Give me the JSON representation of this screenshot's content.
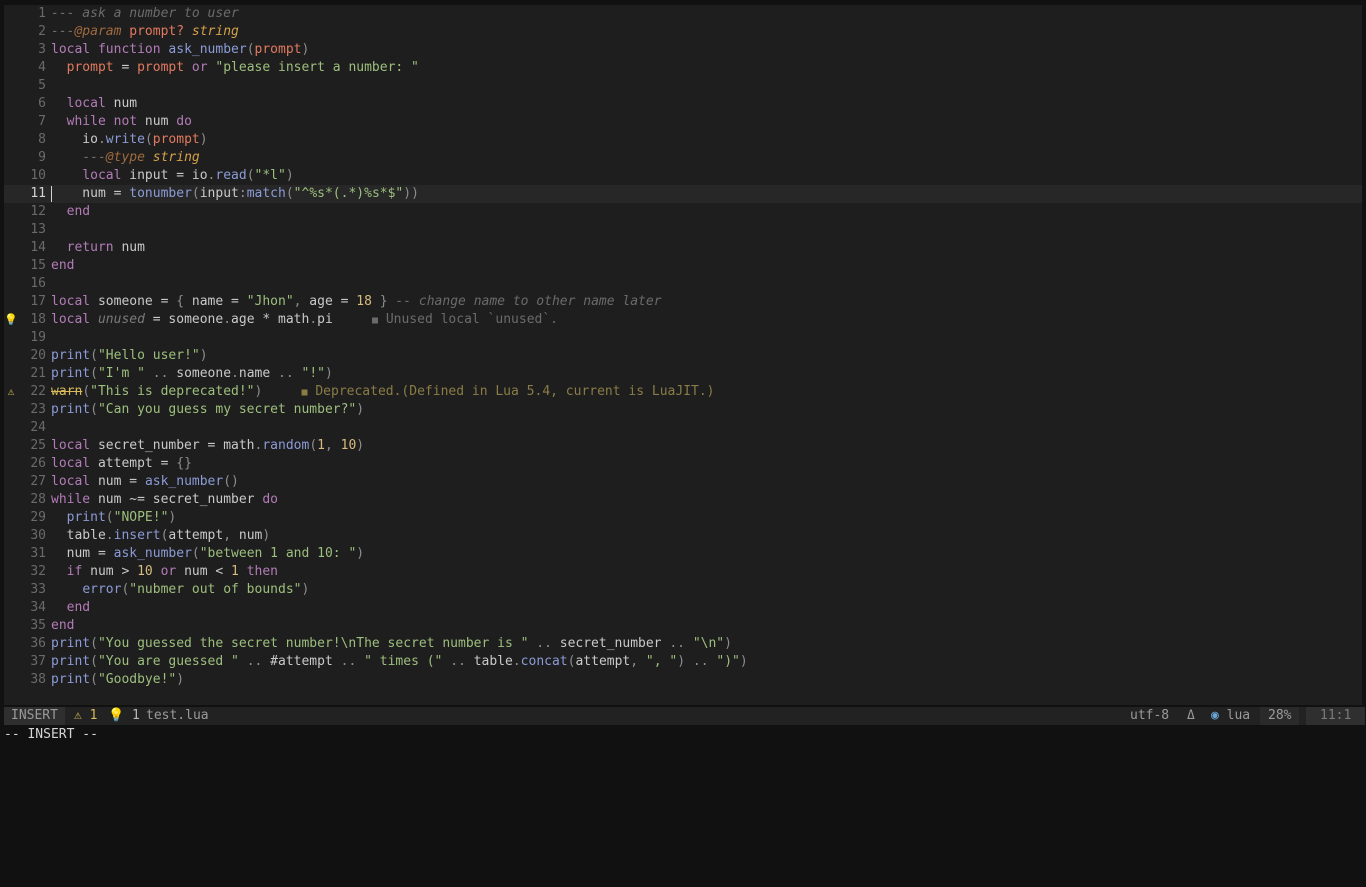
{
  "editor": {
    "lines": [
      {
        "num": "1",
        "code": "--- ask a number to user"
      },
      {
        "num": "2",
        "code": "---@param prompt? string"
      },
      {
        "num": "3",
        "code": "local function ask_number(prompt)"
      },
      {
        "num": "4",
        "code": "  prompt = prompt or \"please insert a number: \""
      },
      {
        "num": "5",
        "code": ""
      },
      {
        "num": "6",
        "code": "  local num"
      },
      {
        "num": "7",
        "code": "  while not num do"
      },
      {
        "num": "8",
        "code": "    io.write(prompt)"
      },
      {
        "num": "9",
        "code": "    ---@type string"
      },
      {
        "num": "10",
        "code": "    local input = io.read(\"*l\")"
      },
      {
        "num": "11",
        "code": "    num = tonumber(input:match(\"^%s*(.*)%s*$\"))"
      },
      {
        "num": "12",
        "code": "  end"
      },
      {
        "num": "13",
        "code": ""
      },
      {
        "num": "14",
        "code": "  return num"
      },
      {
        "num": "15",
        "code": "end"
      },
      {
        "num": "16",
        "code": ""
      },
      {
        "num": "17",
        "code": "local someone = { name = \"Jhon\", age = 18 } -- change name to other name later"
      },
      {
        "num": "18",
        "code": "local unused = someone.age * math.pi",
        "sign": "💡",
        "virt": "Unused local `unused`."
      },
      {
        "num": "19",
        "code": ""
      },
      {
        "num": "20",
        "code": "print(\"Hello user!\")"
      },
      {
        "num": "21",
        "code": "print(\"I'm \" .. someone.name .. \"!\")"
      },
      {
        "num": "22",
        "code": "warn(\"This is deprecated!\")",
        "sign": "⚠",
        "virt": "Deprecated.(Defined in Lua 5.4, current is LuaJIT.)"
      },
      {
        "num": "23",
        "code": "print(\"Can you guess my secret number?\")"
      },
      {
        "num": "24",
        "code": ""
      },
      {
        "num": "25",
        "code": "local secret_number = math.random(1, 10)"
      },
      {
        "num": "26",
        "code": "local attempt = {}"
      },
      {
        "num": "27",
        "code": "local num = ask_number()"
      },
      {
        "num": "28",
        "code": "while num ~= secret_number do"
      },
      {
        "num": "29",
        "code": "  print(\"NOPE!\")"
      },
      {
        "num": "30",
        "code": "  table.insert(attempt, num)"
      },
      {
        "num": "31",
        "code": "  num = ask_number(\"between 1 and 10: \")"
      },
      {
        "num": "32",
        "code": "  if num > 10 or num < 1 then"
      },
      {
        "num": "33",
        "code": "    error(\"nubmer out of bounds\")"
      },
      {
        "num": "34",
        "code": "  end"
      },
      {
        "num": "35",
        "code": "end"
      },
      {
        "num": "36",
        "code": "print(\"You guessed the secret number!\\nThe secret number is \" .. secret_number .. \"\\n\")"
      },
      {
        "num": "37",
        "code": "print(\"You are guessed \" .. #attempt .. \" times (\" .. table.concat(attempt, \", \") .. \")\")"
      },
      {
        "num": "38",
        "code": "print(\"Goodbye!\")"
      }
    ]
  },
  "statusline": {
    "mode": "INSERT",
    "warn_count": "⚠ 1",
    "hint_count": "💡 1",
    "filename": "test.lua",
    "encoding": "utf-8",
    "git_icon": "Δ",
    "filetype_icon": "◉",
    "filetype": "lua",
    "percent": "28%",
    "position": "11:1"
  },
  "cmdline": {
    "text": "-- INSERT --"
  },
  "colors": {
    "background": "#1e1e1e",
    "keyword": "#b37bb8",
    "string": "#9dbf7d",
    "number": "#d7ba7d",
    "function": "#8b9bd6",
    "parameter": "#e07a5f",
    "comment": "#6b6b6b",
    "warning": "#d7b95b"
  }
}
